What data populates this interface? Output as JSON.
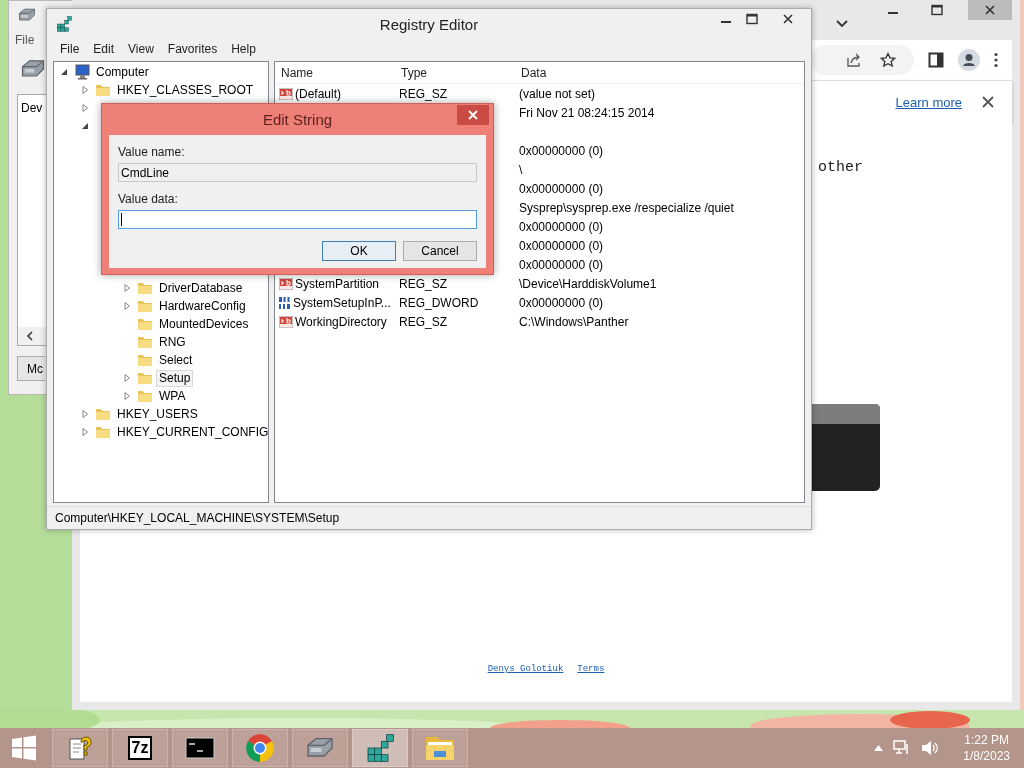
{
  "device_manager": {
    "menu": [
      "File"
    ],
    "list_item": "Dev",
    "button": "Mc"
  },
  "browser": {
    "infobar": {
      "link": "Learn more"
    },
    "page": {
      "text": "other",
      "footer_links": [
        "Denys Golotiuk",
        "Terms"
      ]
    }
  },
  "registry_editor": {
    "title": "Registry Editor",
    "menu": [
      "File",
      "Edit",
      "View",
      "Favorites",
      "Help"
    ],
    "tree": [
      {
        "label": "Computer",
        "kind": "computer",
        "expanded": true,
        "selected": false,
        "children": [
          {
            "label": "HKEY_CLASSES_ROOT",
            "kind": "folder",
            "expanded": false,
            "selected": false
          },
          {
            "expanded": false
          },
          {
            "expanded": true,
            "children": [
              {
                "children": [
                  {
                    "label": "DriverDatabase",
                    "kind": "folder",
                    "expanded": false,
                    "selected": false
                  },
                  {
                    "label": "HardwareConfig",
                    "kind": "folder",
                    "expanded": false,
                    "selected": false
                  },
                  {
                    "label": "MountedDevices",
                    "kind": "folder",
                    "selected": false
                  },
                  {
                    "label": "RNG",
                    "kind": "folder",
                    "selected": false
                  },
                  {
                    "label": "Select",
                    "kind": "folder",
                    "selected": false
                  },
                  {
                    "label": "Setup",
                    "kind": "folder",
                    "expanded": false,
                    "selected": true
                  },
                  {
                    "label": "WPA",
                    "kind": "folder",
                    "expanded": false,
                    "selected": false
                  }
                ]
              }
            ]
          },
          {
            "label": "HKEY_USERS",
            "kind": "folder",
            "expanded": false,
            "selected": false
          },
          {
            "label": "HKEY_CURRENT_CONFIG",
            "kind": "folder",
            "expanded": false,
            "selected": false
          }
        ]
      }
    ],
    "columns": [
      "Name",
      "Type",
      "Data"
    ],
    "rows": [
      {
        "kind": "string",
        "name": "(Default)",
        "type": "REG_SZ",
        "data": "(value not set)"
      },
      {
        "data": "Fri Nov 21 08:24:15 2014"
      },
      {},
      {
        "data": "0x00000000 (0)"
      },
      {
        "data": "\\"
      },
      {
        "data": "0x00000000 (0)"
      },
      {
        "data": "Sysprep\\sysprep.exe /respecialize /quiet"
      },
      {
        "data": "0x00000000 (0)"
      },
      {
        "data": "0x00000000 (0)"
      },
      {
        "data": "0x00000000 (0)"
      },
      {
        "kind": "string",
        "name": "SystemPartition",
        "type": "REG_SZ",
        "data": "\\Device\\HarddiskVolume1"
      },
      {
        "kind": "dword",
        "name": "SystemSetupInP...",
        "type": "REG_DWORD",
        "data": "0x00000000 (0)"
      },
      {
        "kind": "string",
        "name": "WorkingDirectory",
        "type": "REG_SZ",
        "data": "C:\\Windows\\Panther"
      }
    ],
    "status_bar": "Computer\\HKEY_LOCAL_MACHINE\\SYSTEM\\Setup"
  },
  "dialog": {
    "title": "Edit String",
    "fields": [
      {
        "label": "Value name:",
        "value": "CmdLine",
        "readonly": true,
        "focused": false
      },
      {
        "label": "Value data:",
        "readonly": false,
        "focused": true
      }
    ],
    "buttons": [
      {
        "label": "OK",
        "default": true
      },
      {
        "label": "Cancel",
        "default": false
      }
    ]
  },
  "taskbar": {
    "apps": [
      {
        "kind": "help",
        "selected": false
      },
      {
        "kind": "archiver",
        "badge": "7z",
        "selected": false
      },
      {
        "kind": "console",
        "selected": false
      },
      {
        "kind": "browser",
        "selected": false
      },
      {
        "kind": "drive",
        "selected": false
      },
      {
        "kind": "registry",
        "selected": true
      },
      {
        "kind": "folder",
        "selected": false
      }
    ],
    "clock": {
      "time": "1:22 PM",
      "date": "1/8/2023"
    }
  }
}
